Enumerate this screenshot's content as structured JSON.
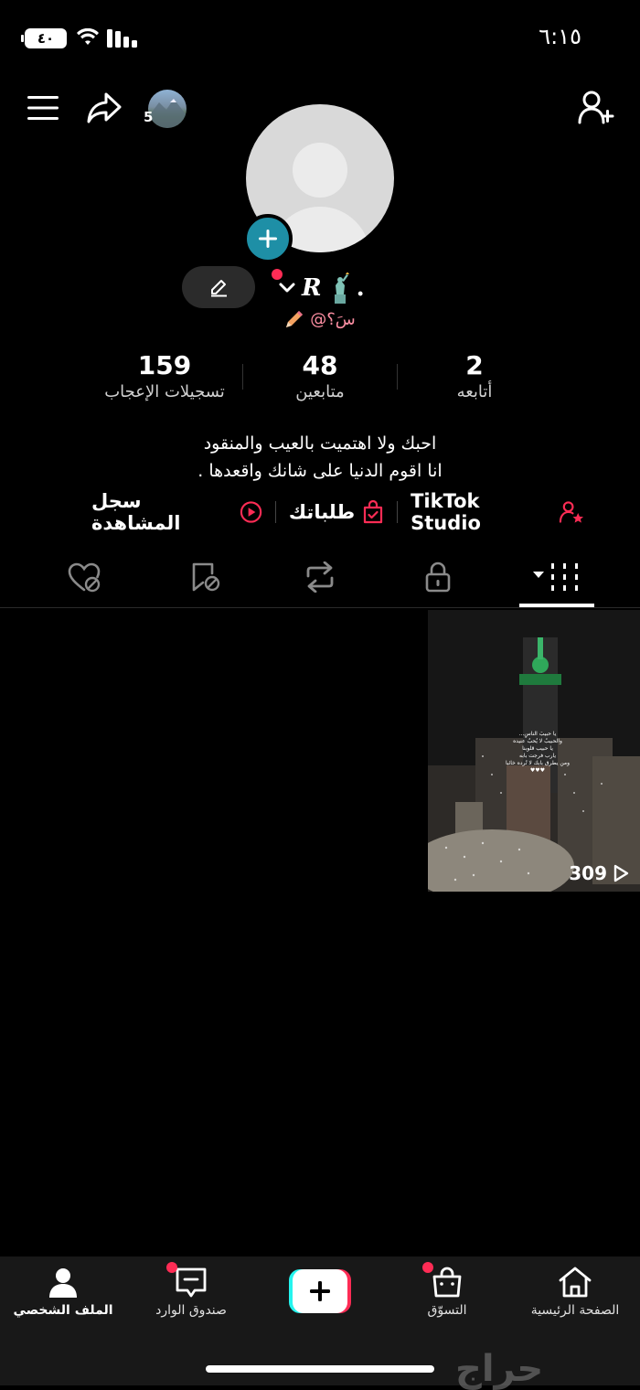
{
  "status_bar": {
    "battery": "٤٠",
    "time": "٦:١٥"
  },
  "header": {
    "story_count": "5"
  },
  "profile": {
    "display_name": "R",
    "handle": "@سَ؟",
    "stats": [
      {
        "value": "159",
        "label": "تسجيلات الإعجاب"
      },
      {
        "value": "48",
        "label": "متابعين"
      },
      {
        "value": "2",
        "label": "أتابعه"
      }
    ],
    "bio_lines": [
      "احبك ولا اهتميت بالعيب والمنقود",
      "انا اقوم الدنيا على شانك واقعدها ."
    ],
    "links": {
      "studio": "TikTok Studio",
      "orders": "طلباتك",
      "history": "سجل المشاهدة"
    }
  },
  "video": {
    "views": "309",
    "overlay_lines": [
      "...يا حبيبَ الناسِ",
      "والحبيبُ لا يُحبُ عنيده",
      "يا حبيب قلوبنا",
      "يارب فرجت بابه",
      "ومن يطرق بابك لا تُرده خائبا",
      "♥♥♥"
    ]
  },
  "bottom_nav": [
    {
      "label": "الصفحة الرئيسية",
      "icon": "home-icon"
    },
    {
      "label": "التسوّق",
      "icon": "shop-icon"
    },
    {
      "label": "",
      "icon": "create-icon"
    },
    {
      "label": "صندوق الوارد",
      "icon": "inbox-icon"
    },
    {
      "label": "الملف الشخصي",
      "icon": "profile-icon"
    }
  ],
  "watermark": "حراج",
  "colors": {
    "accent_red": "#fe2c55",
    "teal": "#1e8fa6",
    "background": "#000000"
  }
}
